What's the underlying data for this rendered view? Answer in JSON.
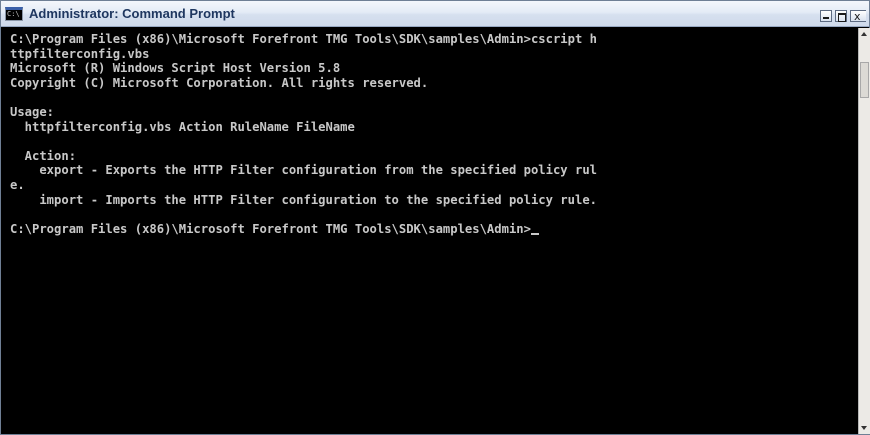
{
  "window": {
    "title": "Administrator: Command Prompt",
    "icon": "cmd-icon",
    "icon_glyph": "C:\\"
  },
  "controls": {
    "minimize": "minimize-icon",
    "maximize": "maximize-icon",
    "close": "close-icon",
    "close_glyph": "x"
  },
  "console": {
    "background": "#000000",
    "foreground": "#c8c8c8",
    "lines": [
      "C:\\Program Files (x86)\\Microsoft Forefront TMG Tools\\SDK\\samples\\Admin>cscript h",
      "ttpfilterconfig.vbs",
      "Microsoft (R) Windows Script Host Version 5.8",
      "Copyright (C) Microsoft Corporation. All rights reserved.",
      "",
      "Usage:",
      "  httpfilterconfig.vbs Action RuleName FileName",
      "",
      "  Action:",
      "    export - Exports the HTTP Filter configuration from the specified policy rul",
      "e.",
      "    import - Imports the HTTP Filter configuration to the specified policy rule.",
      "",
      "C:\\Program Files (x86)\\Microsoft Forefront TMG Tools\\SDK\\samples\\Admin>"
    ]
  }
}
